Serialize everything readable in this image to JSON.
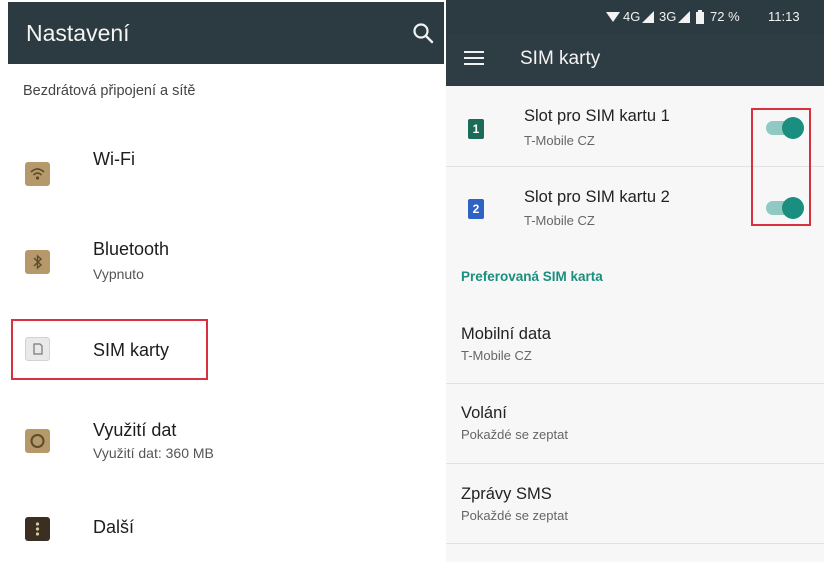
{
  "settings": {
    "title": "Nastavení",
    "section": "Bezdrátová připojení a sítě",
    "items": [
      {
        "title": "Wi-Fi",
        "subtitle": "",
        "icon": "wifi-icon"
      },
      {
        "title": "Bluetooth",
        "subtitle": "Vypnuto",
        "icon": "bluetooth-icon"
      },
      {
        "title": "SIM karty",
        "subtitle": "",
        "icon": "sim-card-icon"
      },
      {
        "title": "Využití dat",
        "subtitle": "Využití dat: 360 MB",
        "icon": "data-usage-icon"
      },
      {
        "title": "Další",
        "subtitle": "",
        "icon": "more-icon"
      }
    ]
  },
  "status_bar": {
    "network_1": "4G",
    "network_2": "3G",
    "battery": "72 %",
    "time": "11:13"
  },
  "sim_screen": {
    "title": "SIM karty",
    "slots": [
      {
        "badge": "1",
        "title": "Slot pro SIM kartu 1",
        "subtitle": "T-Mobile CZ",
        "enabled": true,
        "color": "#1a6b57"
      },
      {
        "badge": "2",
        "title": "Slot pro SIM kartu 2",
        "subtitle": "T-Mobile CZ",
        "enabled": true,
        "color": "#2e63c6"
      }
    ],
    "preferred_label": "Preferovaná SIM karta",
    "preferences": [
      {
        "title": "Mobilní data",
        "subtitle": "T-Mobile CZ"
      },
      {
        "title": "Volání",
        "subtitle": "Pokaždé se zeptat"
      },
      {
        "title": "Zprávy SMS",
        "subtitle": "Pokaždé se zeptat"
      }
    ]
  },
  "colors": {
    "appbar": "#2c3a41",
    "accent": "#1a8f7f",
    "highlight": "#d93040"
  }
}
